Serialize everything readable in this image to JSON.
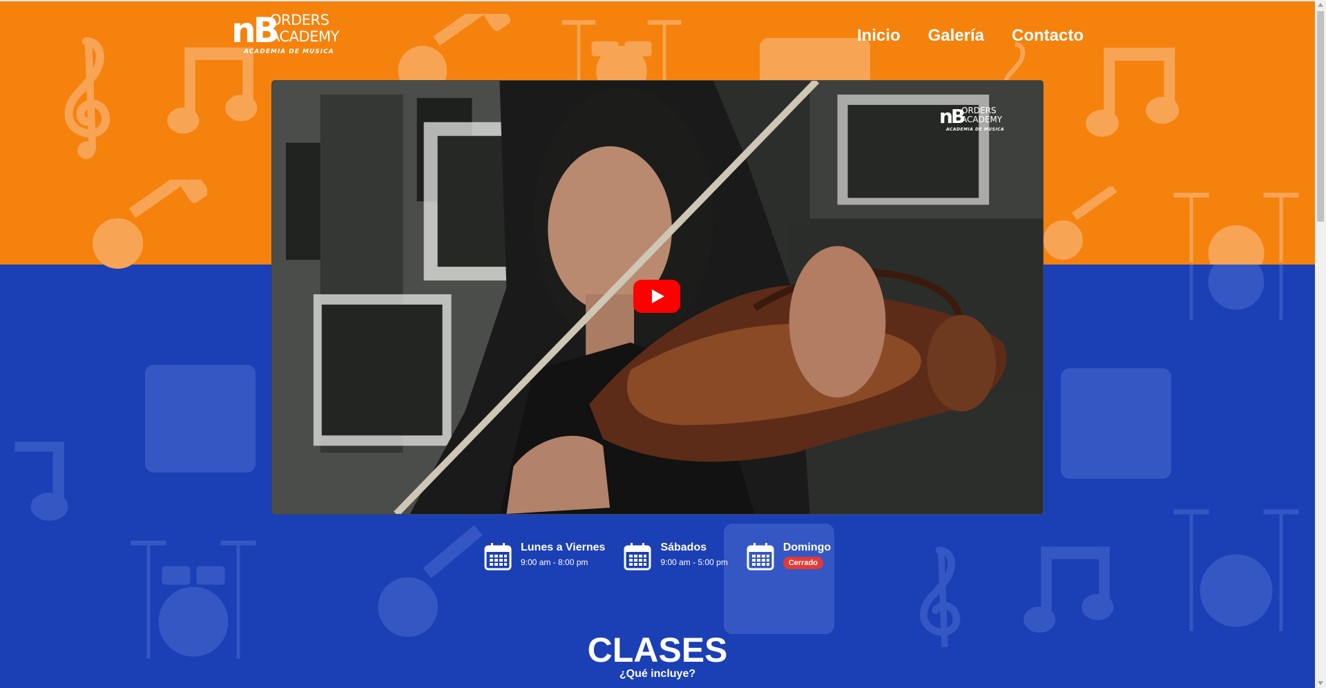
{
  "brand": {
    "mark": "nB",
    "line1": "ORDERS",
    "line2": "ACADEMY",
    "tagline": "ACADEMIA DE MUSICA"
  },
  "nav": {
    "items": [
      {
        "label": "Inicio"
      },
      {
        "label": "Galería"
      },
      {
        "label": "Contacto"
      }
    ]
  },
  "video": {
    "watermark_mark": "nB",
    "watermark_line1": "ORDERS",
    "watermark_line2": "ACADEMY",
    "watermark_tagline": "ACADEMIA DE MUSICA",
    "play_icon": "youtube-play-icon"
  },
  "hours": [
    {
      "day": "Lunes a Viernes",
      "time": "9:00 am - 8:00 pm"
    },
    {
      "day": "Sábados",
      "time": "9:00 am - 5:00 pm"
    },
    {
      "day": "Domingo",
      "status": "Cerrado"
    }
  ],
  "section": {
    "title": "CLASES",
    "subtitle": "¿Qué incluye?"
  },
  "colors": {
    "orange": "#f5820d",
    "blue": "#1b3fb4",
    "closed_badge": "#e53935",
    "play_red": "#ff0000"
  }
}
